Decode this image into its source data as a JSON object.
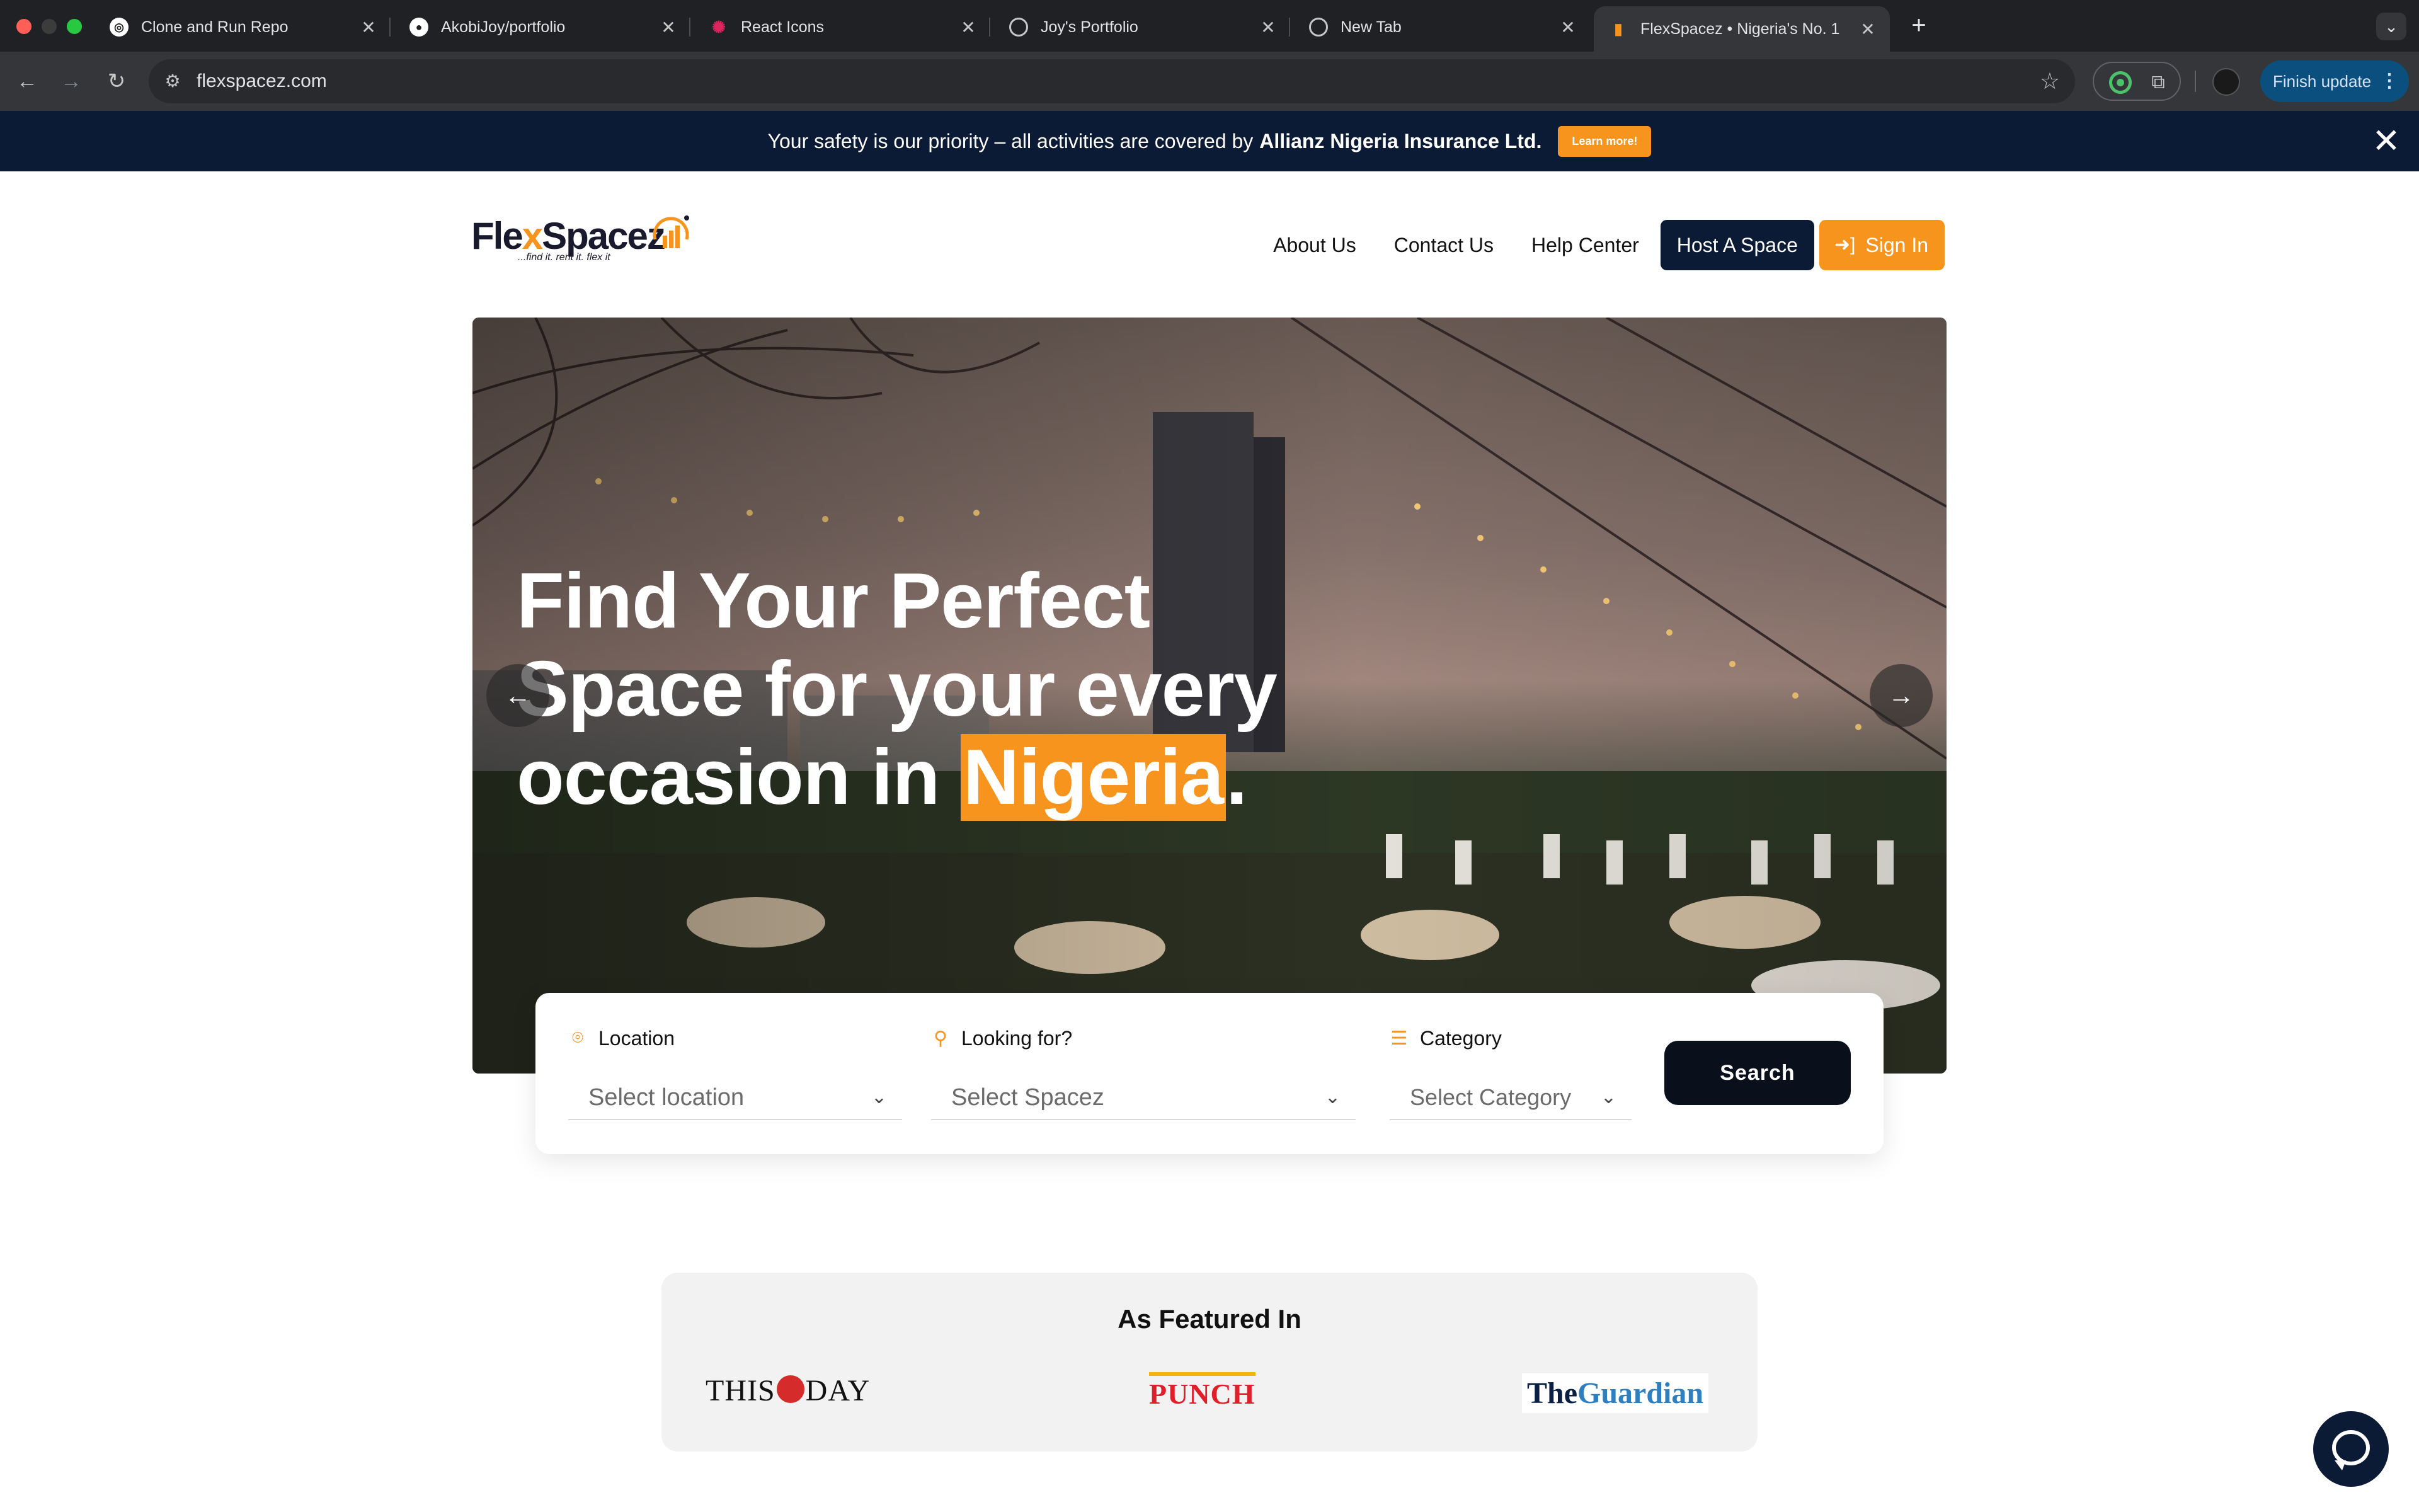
{
  "browser": {
    "tabs": [
      {
        "title": "Clone and Run Repo",
        "icon": "openai-icon"
      },
      {
        "title": "AkobiJoy/portfolio",
        "icon": "github-icon"
      },
      {
        "title": "React Icons",
        "icon": "react-icon"
      },
      {
        "title": "Joy's Portfolio",
        "icon": "globe-icon"
      },
      {
        "title": "New Tab",
        "icon": "chrome-icon"
      },
      {
        "title": "FlexSpacez • Nigeria's No. 1",
        "icon": "flexspacez-icon",
        "active": true
      }
    ],
    "url": "flexspacez.com",
    "finish_update": "Finish update"
  },
  "announcement": {
    "text": "Your safety is our priority – all activities are covered by",
    "bold": "Allianz Nigeria Insurance Ltd.",
    "cta": "Learn more!"
  },
  "brand": {
    "name_part1": "Fle",
    "name_x": "x",
    "name_part2": "Spacez",
    "tagline": "...find it. rent it. flex it",
    "accent": "#f7941d",
    "navy": "#0b1a35"
  },
  "nav": {
    "about": "About Us",
    "contact": "Contact Us",
    "help": "Help Center",
    "host": "Host A Space",
    "signin": "Sign In"
  },
  "hero": {
    "line1": "Find Your Perfect",
    "line2": "Space for your every",
    "line3_prefix": "occasion in",
    "highlight": "Nigeria",
    "line3_suffix": "."
  },
  "search": {
    "location_label": "Location",
    "location_value": "Select location",
    "looking_label": "Looking for?",
    "looking_value": "Select Spacez",
    "category_label": "Category",
    "category_value": "Select Category",
    "button": "Search"
  },
  "featured": {
    "title": "As Featured In",
    "thisday_a": "THIS",
    "thisday_b": "DAY",
    "punch": "PUNCH",
    "guardian_the": "The",
    "guardian_name": "Guardian"
  }
}
